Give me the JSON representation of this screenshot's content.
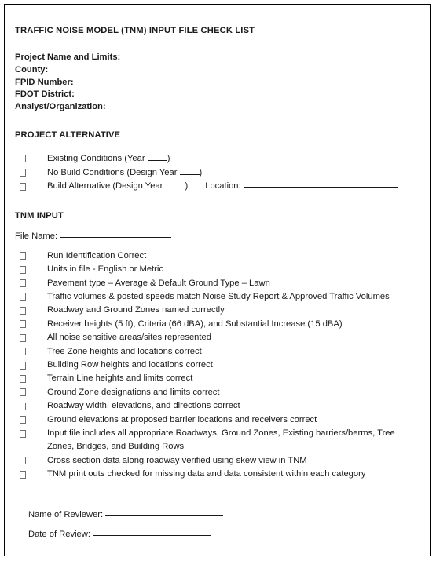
{
  "document": {
    "title": "TRAFFIC NOISE MODEL (TNM) INPUT FILE CHECK LIST",
    "header_fields": [
      "Project Name and Limits:",
      "County:",
      "FPID Number:",
      "FDOT District:",
      "Analyst/Organization:"
    ],
    "project_alternative": {
      "heading": "PROJECT ALTERNATIVE",
      "options": [
        {
          "pre": "Existing Conditions (Year ",
          "post": ")",
          "has_year_blank": true,
          "has_location": false
        },
        {
          "pre": "No Build Conditions (Design Year ",
          "post": ")",
          "has_year_blank": true,
          "has_location": false
        },
        {
          "pre": "Build Alternative (Design Year ",
          "post": ")",
          "has_year_blank": true,
          "has_location": true,
          "location_label": "Location:"
        }
      ]
    },
    "tnm_input": {
      "heading": "TNM INPUT",
      "file_name_label": "File Name:",
      "items": [
        "Run Identification Correct",
        "Units in file - English or Metric",
        "Pavement type – Average & Default Ground Type – Lawn",
        "Traffic volumes & posted speeds match Noise Study Report & Approved Traffic Volumes",
        "Roadway and Ground Zones named correctly",
        "Receiver heights (5 ft), Criteria (66 dBA), and Substantial Increase (15 dBA)",
        "All noise sensitive areas/sites represented",
        "Tree Zone heights and locations correct",
        "Building Row heights and locations correct",
        "Terrain Line heights and limits correct",
        "Ground Zone designations and limits correct",
        "Roadway width, elevations, and directions correct",
        "Ground elevations at proposed barrier locations and receivers correct",
        "Input file includes all appropriate Roadways, Ground Zones, Existing barriers/berms, Tree Zones, Bridges, and Building Rows",
        "Cross section data along roadway verified using skew view in TNM",
        "TNM print outs checked for missing data and data consistent within each category"
      ]
    },
    "signature": {
      "reviewer_label": "Name of Reviewer:",
      "date_label": "Date of Review:"
    }
  }
}
